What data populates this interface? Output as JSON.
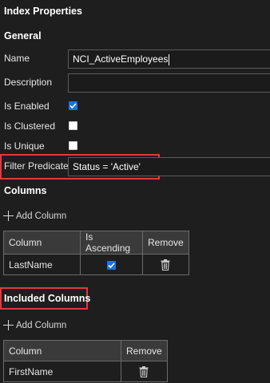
{
  "panel": {
    "title": "Index Properties"
  },
  "general": {
    "heading": "General",
    "name_label": "Name",
    "name_value": "NCI_ActiveEmployees",
    "description_label": "Description",
    "description_value": "",
    "is_enabled_label": "Is Enabled",
    "is_enabled": true,
    "is_clustered_label": "Is Clustered",
    "is_clustered": false,
    "is_unique_label": "Is Unique",
    "is_unique": false,
    "filter_predicate_label": "Filter Predicate",
    "filter_predicate_value": "Status = 'Active'"
  },
  "columns": {
    "heading": "Columns",
    "add_label": "Add Column",
    "headers": [
      "Column",
      "Is Ascending",
      "Remove"
    ],
    "rows": [
      {
        "column": "LastName",
        "is_ascending": true
      }
    ]
  },
  "included_columns": {
    "heading": "Included Columns",
    "add_label": "Add Column",
    "headers": [
      "Column",
      "Remove"
    ],
    "rows": [
      {
        "column": "FirstName"
      }
    ]
  },
  "colors": {
    "background": "#1e1e1e",
    "highlight": "#e0393e",
    "checkbox_checked": "#1e74d4",
    "header_bg": "#3a3a3a"
  },
  "icons": {
    "check": "check-icon",
    "trash": "trash-icon",
    "plus": "plus-icon"
  }
}
